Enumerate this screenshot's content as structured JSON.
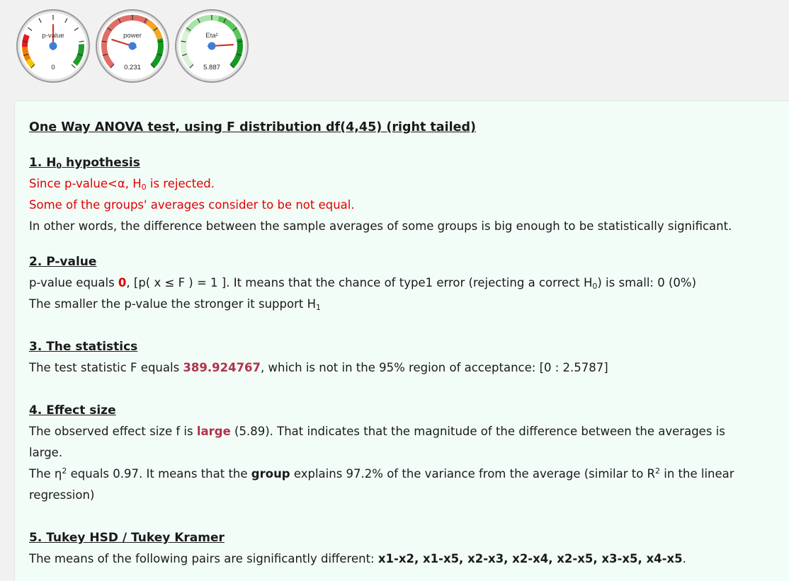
{
  "gauges": [
    {
      "label": "p-value",
      "value": "0",
      "needle_fraction": 0.5
    },
    {
      "label": "power",
      "value": "0.231",
      "needle_fraction": 0.231
    },
    {
      "label": "Eta²",
      "value": "5.887",
      "needle_fraction": 0.82
    }
  ],
  "title": "One Way ANOVA test, using F distribution df(4,45) (right tailed)",
  "s1": {
    "heading": "1. H",
    "heading_sub": "0",
    "heading_rest": " hypothesis",
    "l1a": "Since p-value<α, H",
    "l1sub": "0",
    "l1b": " is rejected.",
    "l2": "Some of the groups' averages consider to be not equal.",
    "l3": "In other words, the difference between the sample averages of some groups is big enough to be statistically significant."
  },
  "s2": {
    "heading": "2. P-value",
    "l1a": "p-value equals ",
    "l1val": "0",
    "l1b": ", [p( x ≤ F ) = 1 ]. It means that the chance of type1 error (rejecting a correct H",
    "l1sub": "0",
    "l1c": ") is small: 0 (0%)",
    "l2a": "The smaller the p-value the stronger it support H",
    "l2sub": "1"
  },
  "s3": {
    "heading": "3. The statistics",
    "l1a": "The test statistic F equals ",
    "l1val": "389.924767",
    "l1b": ", which is not in the 95% region of acceptance: [0 : 2.5787]"
  },
  "s4": {
    "heading": "4. Effect size",
    "l1a": "The observed effect size f is ",
    "l1val": "large",
    "l1b": " (5.89). That indicates that the magnitude of the difference between the averages is",
    "l2": "large.",
    "l3a": "The η",
    "l3sup": "2",
    "l3b": " equals 0.97. It means that the ",
    "l3bold": "group",
    "l3c": " explains 97.2% of the variance from the average (similar to R",
    "l3sup2": "2",
    "l3d": " in the linear",
    "l4": "regression)"
  },
  "s5": {
    "heading": "5. Tukey HSD / Tukey Kramer",
    "l1a": "The means of the following pairs are significantly different: ",
    "l1bold": "x1-x2, x1-x5, x2-x3, x2-x4, x2-x5, x3-x5, x4-x5",
    "l1c": "."
  },
  "colors": {
    "red": "#e00000",
    "value": "#b0324a",
    "green": "#129a1e",
    "orange": "#f5a623",
    "panel_bg": "#f3fdf8"
  }
}
